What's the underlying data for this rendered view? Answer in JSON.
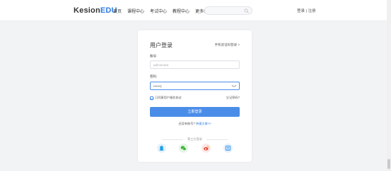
{
  "header": {
    "logo_main": "Kesion",
    "logo_accent": "EDU",
    "nav": [
      "首页",
      "课程中心",
      "考试中心",
      "教程中心",
      "更多频道"
    ],
    "auth_text": "登录 | 注册"
  },
  "card": {
    "title": "用户登录",
    "mobile_login": "手机验证码登录 >",
    "account_label": "账号:",
    "account_value": "admin1hat",
    "password_label": "密码:",
    "password_value": "•••••|",
    "remember": "已同意用户服务协议",
    "forgot": "忘记密码?",
    "login_button": "立即登录",
    "register_text": "还没有账号? ",
    "register_link": "快速注册>>",
    "third_party": "第三方登录"
  },
  "colors": {
    "primary": "#4a8de8",
    "qq": "#1fa0e8",
    "wechat": "#38b23a",
    "weibo": "#e54b3a",
    "alipay": "#1e86e0"
  },
  "icons": [
    "search-icon",
    "eye-icon",
    "qq-icon",
    "wechat-icon",
    "weibo-icon",
    "alipay-icon"
  ]
}
